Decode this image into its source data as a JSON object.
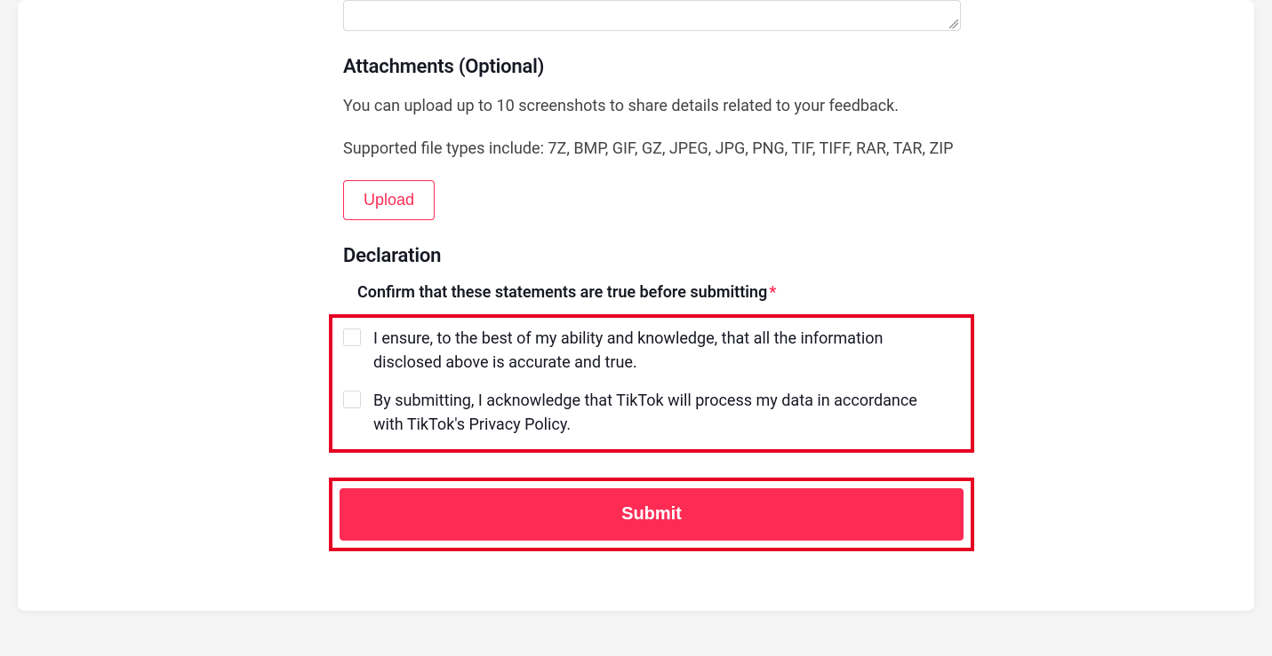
{
  "attachments": {
    "heading": "Attachments (Optional)",
    "helper": "You can upload up to 10 screenshots to share details related to your feedback.",
    "supported": "Supported file types include: 7Z, BMP, GIF, GZ, JPEG, JPG, PNG, TIF, TIFF, RAR, TAR, ZIP",
    "upload_label": "Upload"
  },
  "declaration": {
    "heading": "Declaration",
    "confirm_label": "Confirm that these statements are true before submitting",
    "required_mark": "*",
    "statements": [
      "I ensure, to the best of my ability and knowledge, that all the information disclosed above is accurate and true.",
      "By submitting, I acknowledge that TikTok will process my data in accordance with TikTok's Privacy Policy."
    ]
  },
  "submit": {
    "label": "Submit"
  }
}
